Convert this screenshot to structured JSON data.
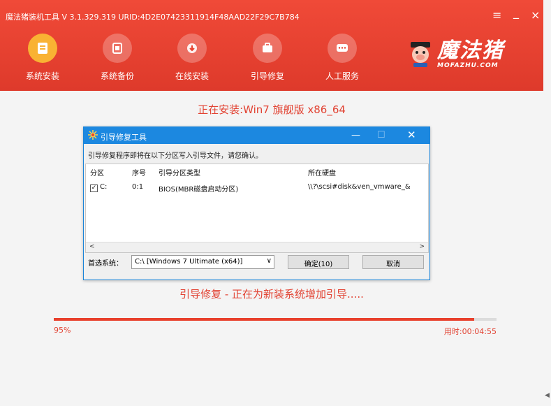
{
  "window": {
    "title": "魔法猪装机工具 V 3.1.329.319 URID:4D2E07423311914F48AAD22F29C7B784",
    "controls": [
      "≡",
      "_",
      "×"
    ]
  },
  "nav": {
    "items": [
      {
        "label": "系统安装",
        "icon": "install-icon",
        "active": true
      },
      {
        "label": "系统备份",
        "icon": "backup-icon"
      },
      {
        "label": "在线安装",
        "icon": "online-install-icon"
      },
      {
        "label": "引导修复",
        "icon": "repair-icon"
      },
      {
        "label": "人工服务",
        "icon": "chat-icon"
      }
    ]
  },
  "logo": {
    "text": "魔法猪",
    "sub": "MOFAZHU.COM",
    "icon": "pig-mascot-icon"
  },
  "main": {
    "installing": "正在安装:Win7 旗舰版 x86_64",
    "status": "引导修复 - 正在为新装系统增加引导.....",
    "progress": {
      "percent": 95,
      "label": "95%",
      "elapsed": "用时:00:04:55"
    }
  },
  "dialog": {
    "title": "引导修复工具",
    "message": "引导修复程序即将在以下分区写入引导文件，请您确认。",
    "columns": [
      "分区",
      "序号",
      "引导分区类型",
      "所在硬盘"
    ],
    "rows": [
      {
        "partition": "C:",
        "checked": true,
        "index": "0:1",
        "type": "BIOS(MBR磁盘启动分区)",
        "disk": "\\\\?\\scsi#disk&ven_vmware_&"
      }
    ],
    "preferred_label": "首选系统：",
    "preferred_value": "C:\\ [Windows 7 Ultimate (x64)]",
    "ok_label": "确定(10)",
    "cancel_label": "取消",
    "accent": "#1c88e0"
  },
  "colors": {
    "brand": "#e8402c",
    "active_nav": "#f9b233"
  }
}
